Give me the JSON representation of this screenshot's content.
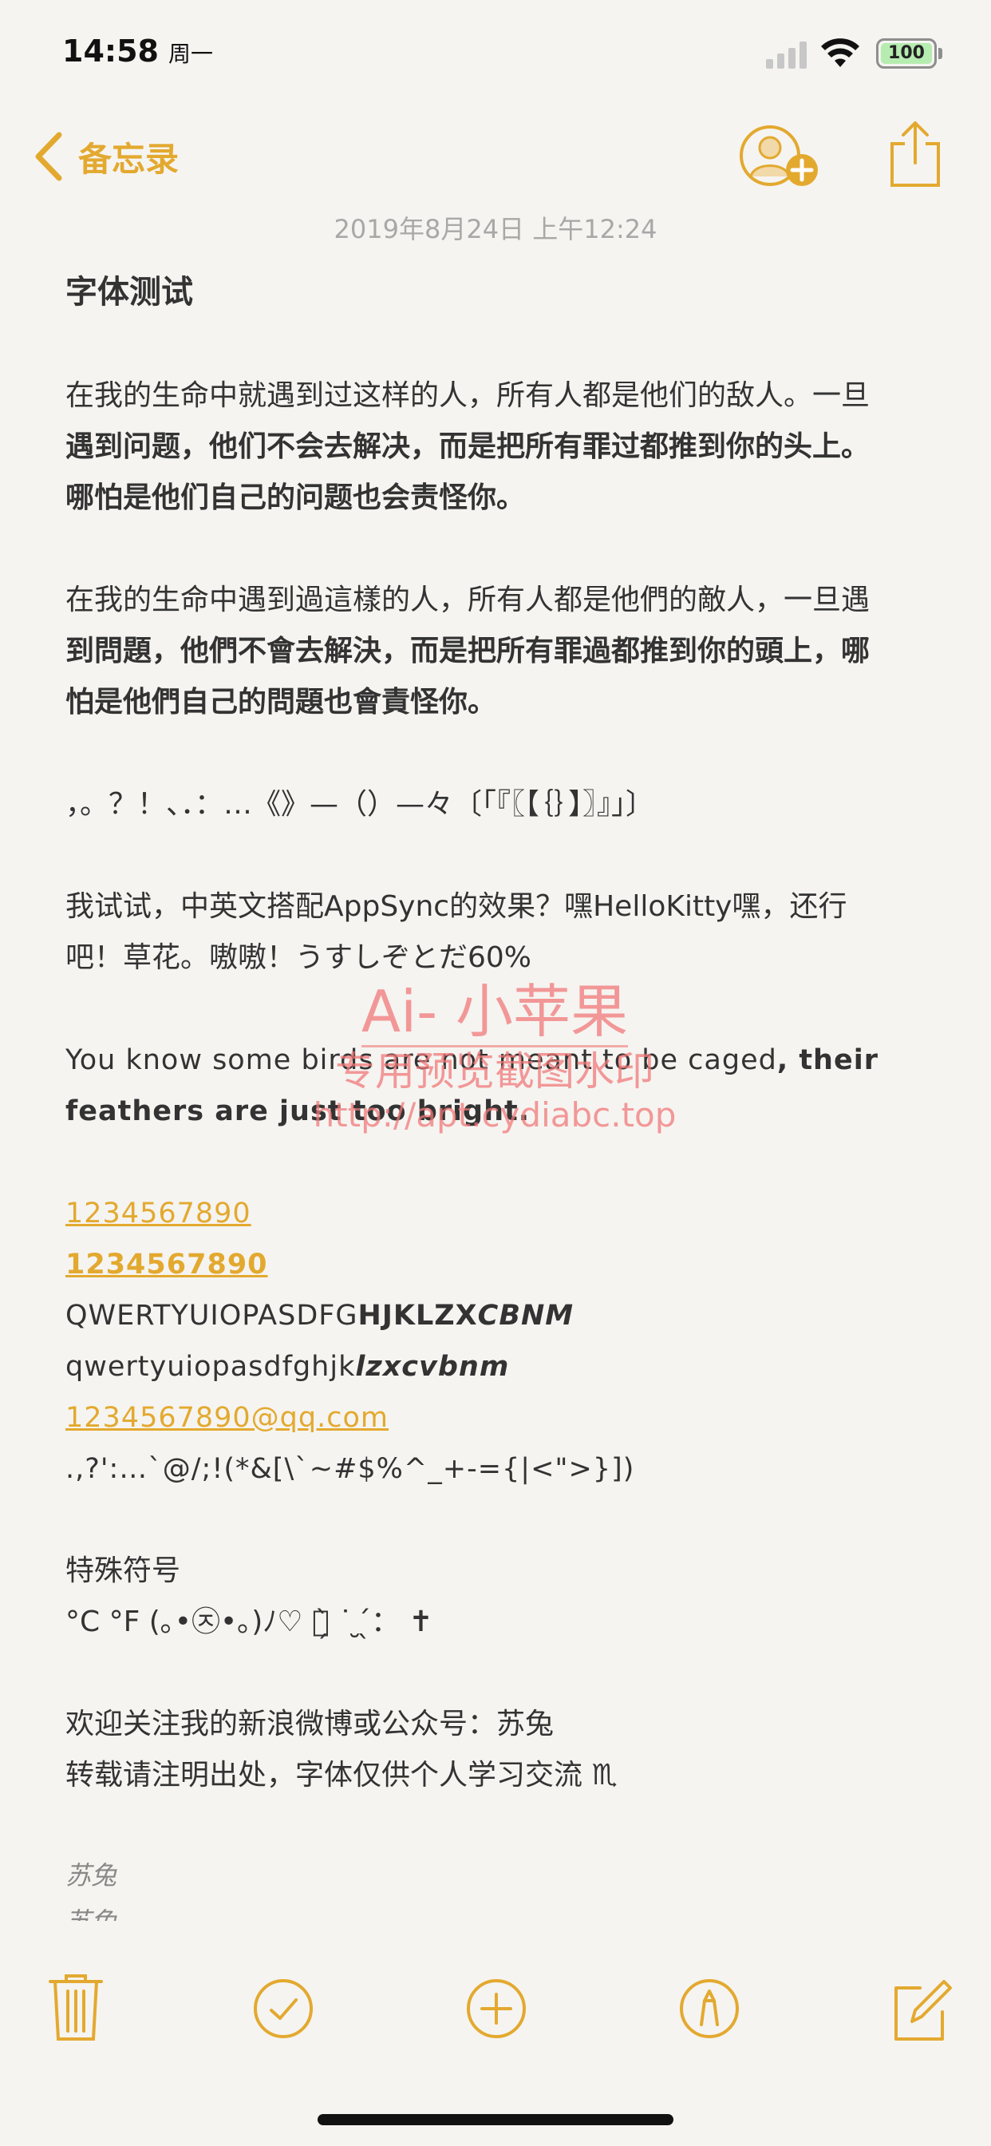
{
  "status_bar": {
    "time": "14:58",
    "day": "周一",
    "battery": "100"
  },
  "nav": {
    "back_label": "备忘录",
    "back_icon": "chevron-left-icon",
    "user_icon": "add-person-icon",
    "share_icon": "share-icon"
  },
  "note": {
    "date": "2019年8月24日 上午12:24",
    "title": "字体测试",
    "para1_a": "在我的生命中就遇到过这样的人，所有人都是他们的敌人。一旦",
    "para1_b": "遇到问题，他们不会去解决，而是把所有罪过都推到你的头上。",
    "para1_c": "哪怕是他们自己的问题也会责怪你。",
    "para2_a": "在我的生命中遇到過這樣的人，所有人都是他們的敵人，一旦遇",
    "para2_b": "到問題，他們不會去解決，而是把所有罪過都推到你的頭上，哪",
    "para2_c": "怕是他們自己的問題也會責怪你。",
    "punct": "，。？！、．：…《》—（）—々〔「『〖【｛｝】〗』」〕",
    "mix_a": "我试试，中英文搭配AppSync的效果？嘿HelloKitty嘿，还行",
    "mix_b": "吧！草花。嗷嗷！うすしぞとだ60%",
    "en_a_normal": "You know some birds are not meant to be caged",
    "en_a_bold": ", their",
    "en_b": "feathers are just too bright.",
    "num_link": "1234567890",
    "num_link_bold": "1234567890",
    "upper_normal": "QWERTYUIOPASDFG",
    "upper_bold": "HJKLZX",
    "upper_italic": "CBNM",
    "lower_normal": "qwertyuiopasdfghjk",
    "lower_italic": "lzxcvbnm",
    "email": "1234567890@qq.com",
    "symbols": ".,?':…`@/;!(*&[\\`~#$%^_+-={|<\">}])",
    "special_title": "特殊符号",
    "special_chars": "°C °F (｡•㉨•｡)ﾉ♡ ：̗̀ ˙ ̮ ̖́：  ✝︎",
    "footer_a": "欢迎关注我的新浪微博或公众号：苏兔",
    "footer_b": "转载请注明出处，字体仅供个人学习交流 ♏︎",
    "sign_a": "苏兔",
    "sign_b": "苏兔"
  },
  "watermark": {
    "line1": "Ai- 小苹果",
    "line2": "专用预览截图水印",
    "line3": "http://apt.cydiabc.top"
  },
  "toolbar": {
    "delete_icon": "trash-icon",
    "checklist_icon": "checkmark-circle-icon",
    "add_icon": "plus-circle-icon",
    "markup_icon": "pen-circle-icon",
    "compose_icon": "compose-icon"
  },
  "colors": {
    "accent": "#e3a92f",
    "background": "#f5f4f1",
    "text": "#333333",
    "date": "#a8a8a8"
  }
}
